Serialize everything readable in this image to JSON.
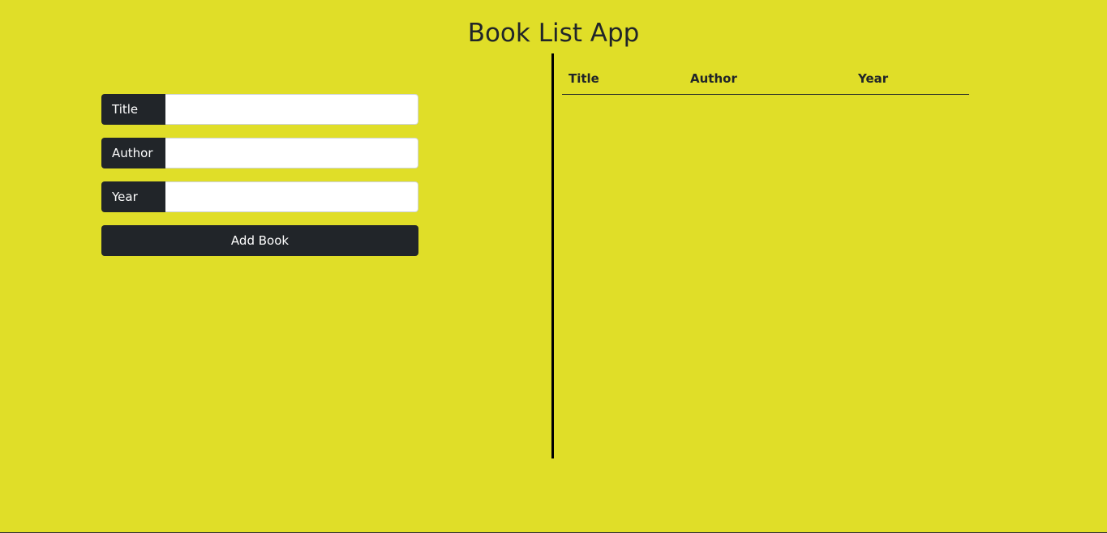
{
  "app": {
    "title": "Book List App"
  },
  "form": {
    "fields": [
      {
        "label": "Title",
        "value": ""
      },
      {
        "label": "Author",
        "value": ""
      },
      {
        "label": "Year",
        "value": ""
      }
    ],
    "submit_label": "Add Book"
  },
  "table": {
    "headers": [
      "Title",
      "Author",
      "Year"
    ],
    "rows": []
  },
  "colors": {
    "background": "#e0de28",
    "dark": "#212529"
  }
}
